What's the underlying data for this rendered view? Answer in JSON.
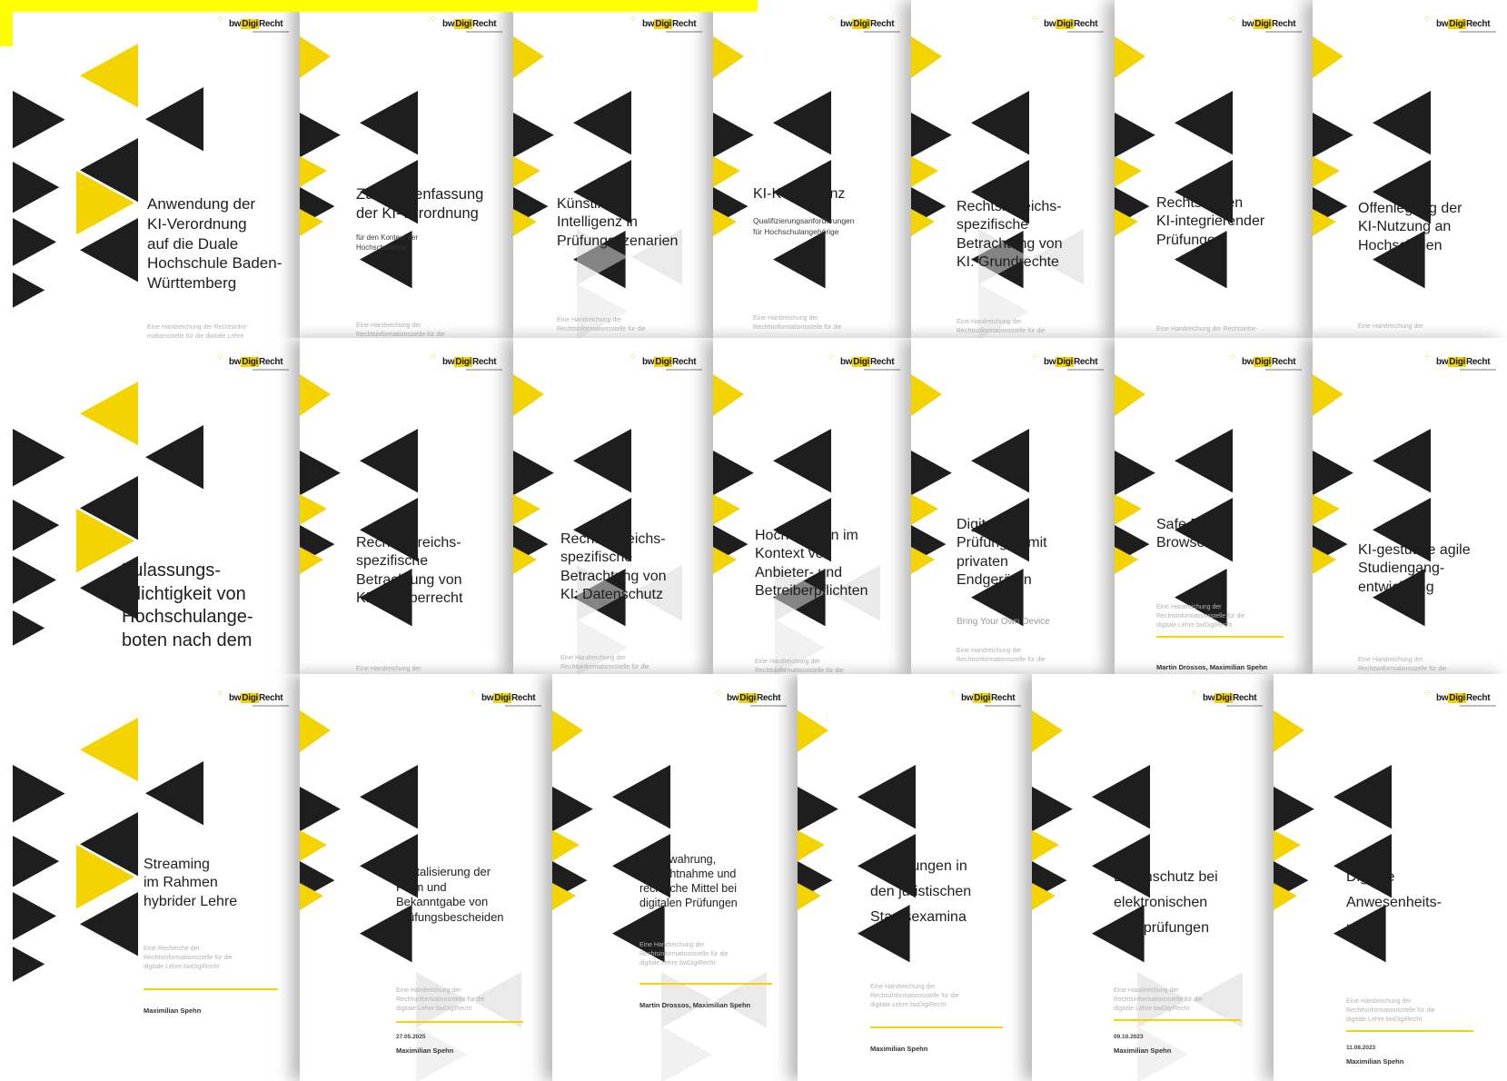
{
  "logo": {
    "prefix": "bw",
    "highlight": "Digi",
    "suffix": "Recht"
  },
  "colors": {
    "accent": "#f3d400",
    "dark": "#1e1e1e",
    "highlight": "#ffff00"
  },
  "rows": [
    {
      "covers": [
        {
          "title": "Anwendung der\nKI-Verordnung\nauf die Duale\nHochschule Baden-\nWürttemberg",
          "desc": "Eine Handreichung der Rechtsinfor-\nmationsstelle für die digitale Lehre"
        },
        {
          "title": "Zusammenfassung\nder KI-Verordnung",
          "subtitle": "für den Kontext der\nHochschullehre",
          "desc": "Eine Handreichung der\nRechtsinformationsstelle für die"
        },
        {
          "title": "Künstliche\nIntelligenz in\nPrüfungsszenarien",
          "desc": "Eine Handreichung der\nRechtsinformationsstelle für die"
        },
        {
          "title": "KI-Kompetenz",
          "subtitle": "Qualifizierungsanforderungen\nfür Hochschulangehörige",
          "desc": "Eine Handreichung der\nRechtsinformationsstelle für die"
        },
        {
          "title": "Rechtsbereichs-\nspezifische\nBetrachtung von\nKI: Grundrechte",
          "desc": "Eine Handreichung der\nRechtsinformationsstelle für die"
        },
        {
          "title": "Rechtsfragen\nKI-integrierender\nPrüfungen",
          "desc": "Eine Handreichung der Rechtsinfor-"
        },
        {
          "title": "Offenlegung der\nKI-Nutzung an\nHochschulen",
          "desc": "Eine Handreichung der"
        }
      ]
    },
    {
      "covers": [
        {
          "title": "Zulassungs-\npflichtigkeit von\nHochschulange-\nboten nach dem",
          "desc": ""
        },
        {
          "title": "Rechtsbereichs-\nspezifische\nBetrachtung von\nKI: Urheberrecht",
          "desc": "Eine Handreichung der"
        },
        {
          "title": "Rechtsbereichs-\nspezifische\nBetrachtung von\nKI: Datenschutz",
          "desc": "Eine Handreichung der\nRechtsinformationsstelle für die"
        },
        {
          "title": "Hochschulen im\nKontext von\nAnbieter- und\nBetreiberpflichten",
          "desc": "Eine Handreichung der\nRechtsinformationsstelle für die"
        },
        {
          "title": "Digitale\nPrüfungen mit\nprivaten\nEndgeräten",
          "subtitle": "Bring Your Own Device",
          "desc": "Eine Handreichung der\nRechtsinformationsstelle für die"
        },
        {
          "title": "Safe Exam\nBrowser",
          "desc": "Eine Handreichung der\nRechtsinformationsstelle für die\ndigitale Lehre bwDigiRecht",
          "author": "Martin Drossos, Maximilian Spehn"
        },
        {
          "title": "KI-gestützte agile\nStudiengang-\nentwicklung",
          "desc": "Eine Handreichung der\nRechtsinformationsstelle für die"
        }
      ]
    },
    {
      "covers": [
        {
          "title": "Streaming\nim Rahmen\nhybrider Lehre",
          "desc": "Eine Recherche der\nRechtsinformationsstelle für die\ndigitale Lehre bwDigiRecht",
          "author": "Maximilian Spehn"
        },
        {
          "title": "Digitalisierung der\nForm und\nBekanntgabe von\nPrüfungsbescheiden",
          "desc": "Eine Handreichung der\nRechtsinformationsstelle für die\ndigitale Lehre bwDigiRecht",
          "date": "27.05.2025",
          "author": "Maximilian Spehn"
        },
        {
          "title": "Aufbewahrung,\nEinsichtnahme und\nrechtliche Mittel bei\ndigitalen Prüfungen",
          "desc": "Eine Handreichung der\nRechtsinformationsstelle für die\ndigitale Lehre bwDigiRecht",
          "author": "Martin Drossos, Maximilian Spehn"
        },
        {
          "title": "E-Prüfungen in\nden juristischen\nStaatsexamina",
          "desc": "Eine Handreichung der\nRechtsinformationsstelle für die\ndigitale Lehre bwDigiRecht",
          "author": "Maximilian Spehn"
        },
        {
          "title": "Datenschutz bei\nelektronischen\nFernprüfungen",
          "desc": "Eine Handreichung der\nRechtsinformationsstelle für die\ndigitale Lehre bwDigiRecht",
          "date": "09.10.2023",
          "author": "Maximilian Spehn"
        },
        {
          "title": "Digitale\nAnwesenheits-\npflicht",
          "desc": "Eine Handreichung der\nRechtsinformationsstelle für die\ndigitale Lehre bwDigiRecht",
          "date": "11.08.2023",
          "author": "Maximilian Spehn"
        }
      ]
    }
  ]
}
